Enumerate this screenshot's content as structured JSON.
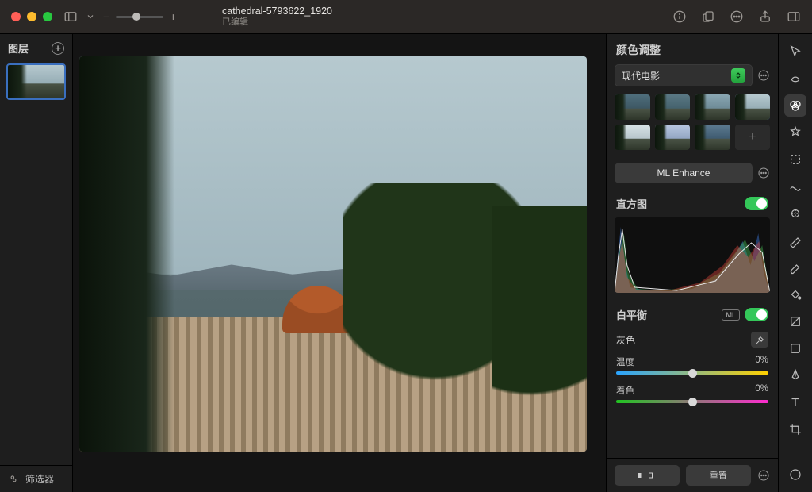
{
  "doc": {
    "title": "cathedral-5793622_1920",
    "status": "已编辑"
  },
  "layers": {
    "header": "图层",
    "footer": "筛选器"
  },
  "inspector": {
    "title": "颜色调整",
    "preset_label": "现代电影",
    "ml_button": "ML Enhance",
    "histogram_label": "直方图",
    "wb_label": "白平衡",
    "ml_chip": "ML",
    "gray_label": "灰色",
    "temperature": {
      "label": "温度",
      "value": "0%"
    },
    "tint": {
      "label": "着色",
      "value": "0%"
    },
    "reset_label": "重置",
    "swatches": [
      {
        "skyA": "#4f6e7c",
        "skyB": "#3d5763"
      },
      {
        "skyA": "#5a7884",
        "skyB": "#45626d"
      },
      {
        "skyA": "#8aa7b3",
        "skyB": "#6e8b97"
      },
      {
        "skyA": "#b6c9cf",
        "skyB": "#96adb5",
        "selected": true
      },
      {
        "skyA": "#d8e2e6",
        "skyB": "#b8c6cc"
      },
      {
        "skyA": "#b8c7e0",
        "skyB": "#93a6c4"
      },
      {
        "skyA": "#5c7a90",
        "skyB": "#3f5b70"
      }
    ]
  }
}
